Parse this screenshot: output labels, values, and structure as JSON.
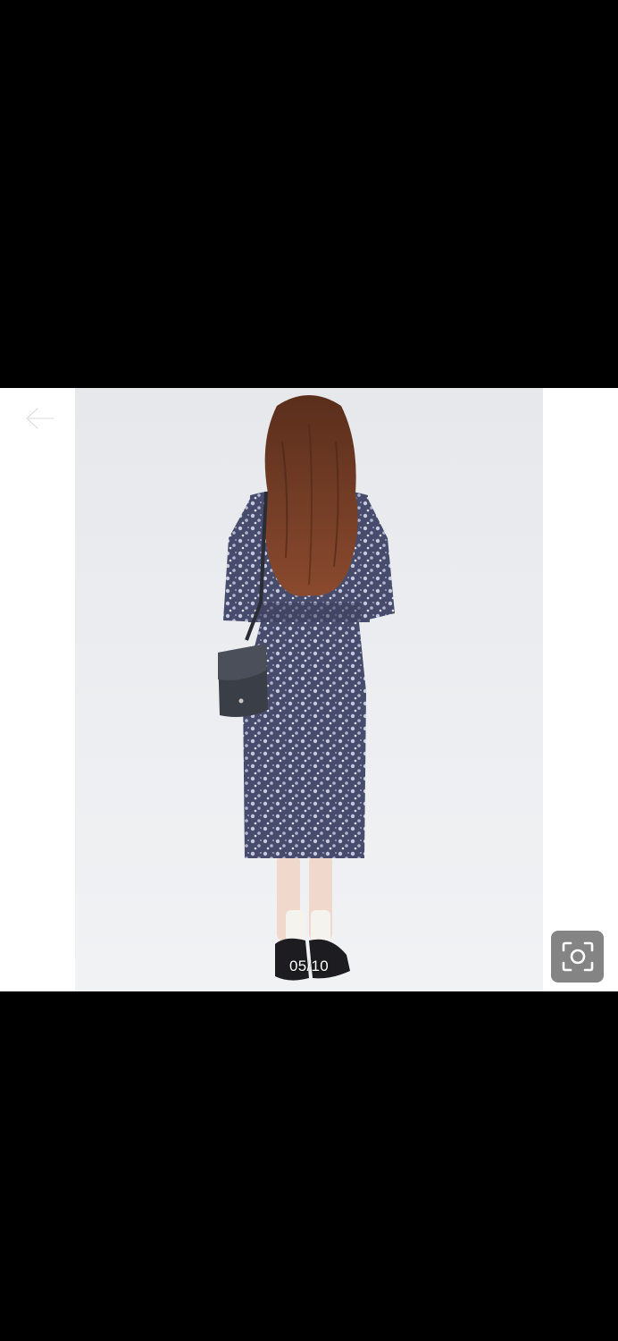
{
  "viewer": {
    "counter": "05/10",
    "back_icon": "arrow-left-icon",
    "scan_icon": "scan-lens-icon"
  },
  "colors": {
    "letterbox": "#000000",
    "photo_band": "#ffffff",
    "counter_text": "#ffffff",
    "scan_button_bg": "#6e6e6e"
  }
}
